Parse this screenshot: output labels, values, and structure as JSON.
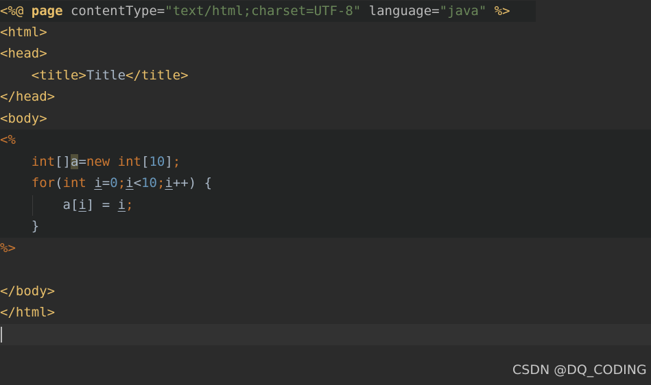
{
  "code": {
    "line1": {
      "open": "<%@ ",
      "page_kw": "page",
      "attr1": " contentType=",
      "val1": "\"text/html;charset=UTF-8\"",
      "attr2": " language=",
      "val2": "\"java\"",
      "close": " %>"
    },
    "line2": "<html>",
    "line3": "<head>",
    "line4": {
      "indent": "    ",
      "open_tag": "<title>",
      "text": "Title",
      "close_tag": "</title>"
    },
    "line5": "</head>",
    "line6": "<body>",
    "line7": "<%",
    "line8": {
      "indent": "    ",
      "type": "int",
      "brackets": "[]",
      "var": "a",
      "eq": "=",
      "new_kw": "new",
      "sp": " ",
      "type2": "int",
      "lb": "[",
      "size": "10",
      "rb": "]",
      "semi": ";"
    },
    "line9": {
      "indent": "    ",
      "for_kw": "for",
      "lp": "(",
      "type": "int",
      "sp": " ",
      "i1": "i",
      "eq": "=",
      "zero": "0",
      "semi1": ";",
      "i2": "i",
      "lt": "<",
      "ten": "10",
      "semi2": ";",
      "i3": "i",
      "inc": "++) {"
    },
    "line10": {
      "indent": "        ",
      "arr": "a",
      "lb": "[",
      "i1": "i",
      "rb": "] = ",
      "i2": "i",
      "semi": ";"
    },
    "line11": "    }",
    "line12": "%>",
    "line13": "",
    "line14": "</body>",
    "line15": "</html>"
  },
  "watermark": "CSDN @DQ_CODING",
  "colors": {
    "background": "#2b2b2b",
    "tag": "#e8bf6a",
    "keyword": "#cc7832",
    "string": "#6a8759",
    "number": "#6897bb",
    "text": "#a9b7c6"
  }
}
